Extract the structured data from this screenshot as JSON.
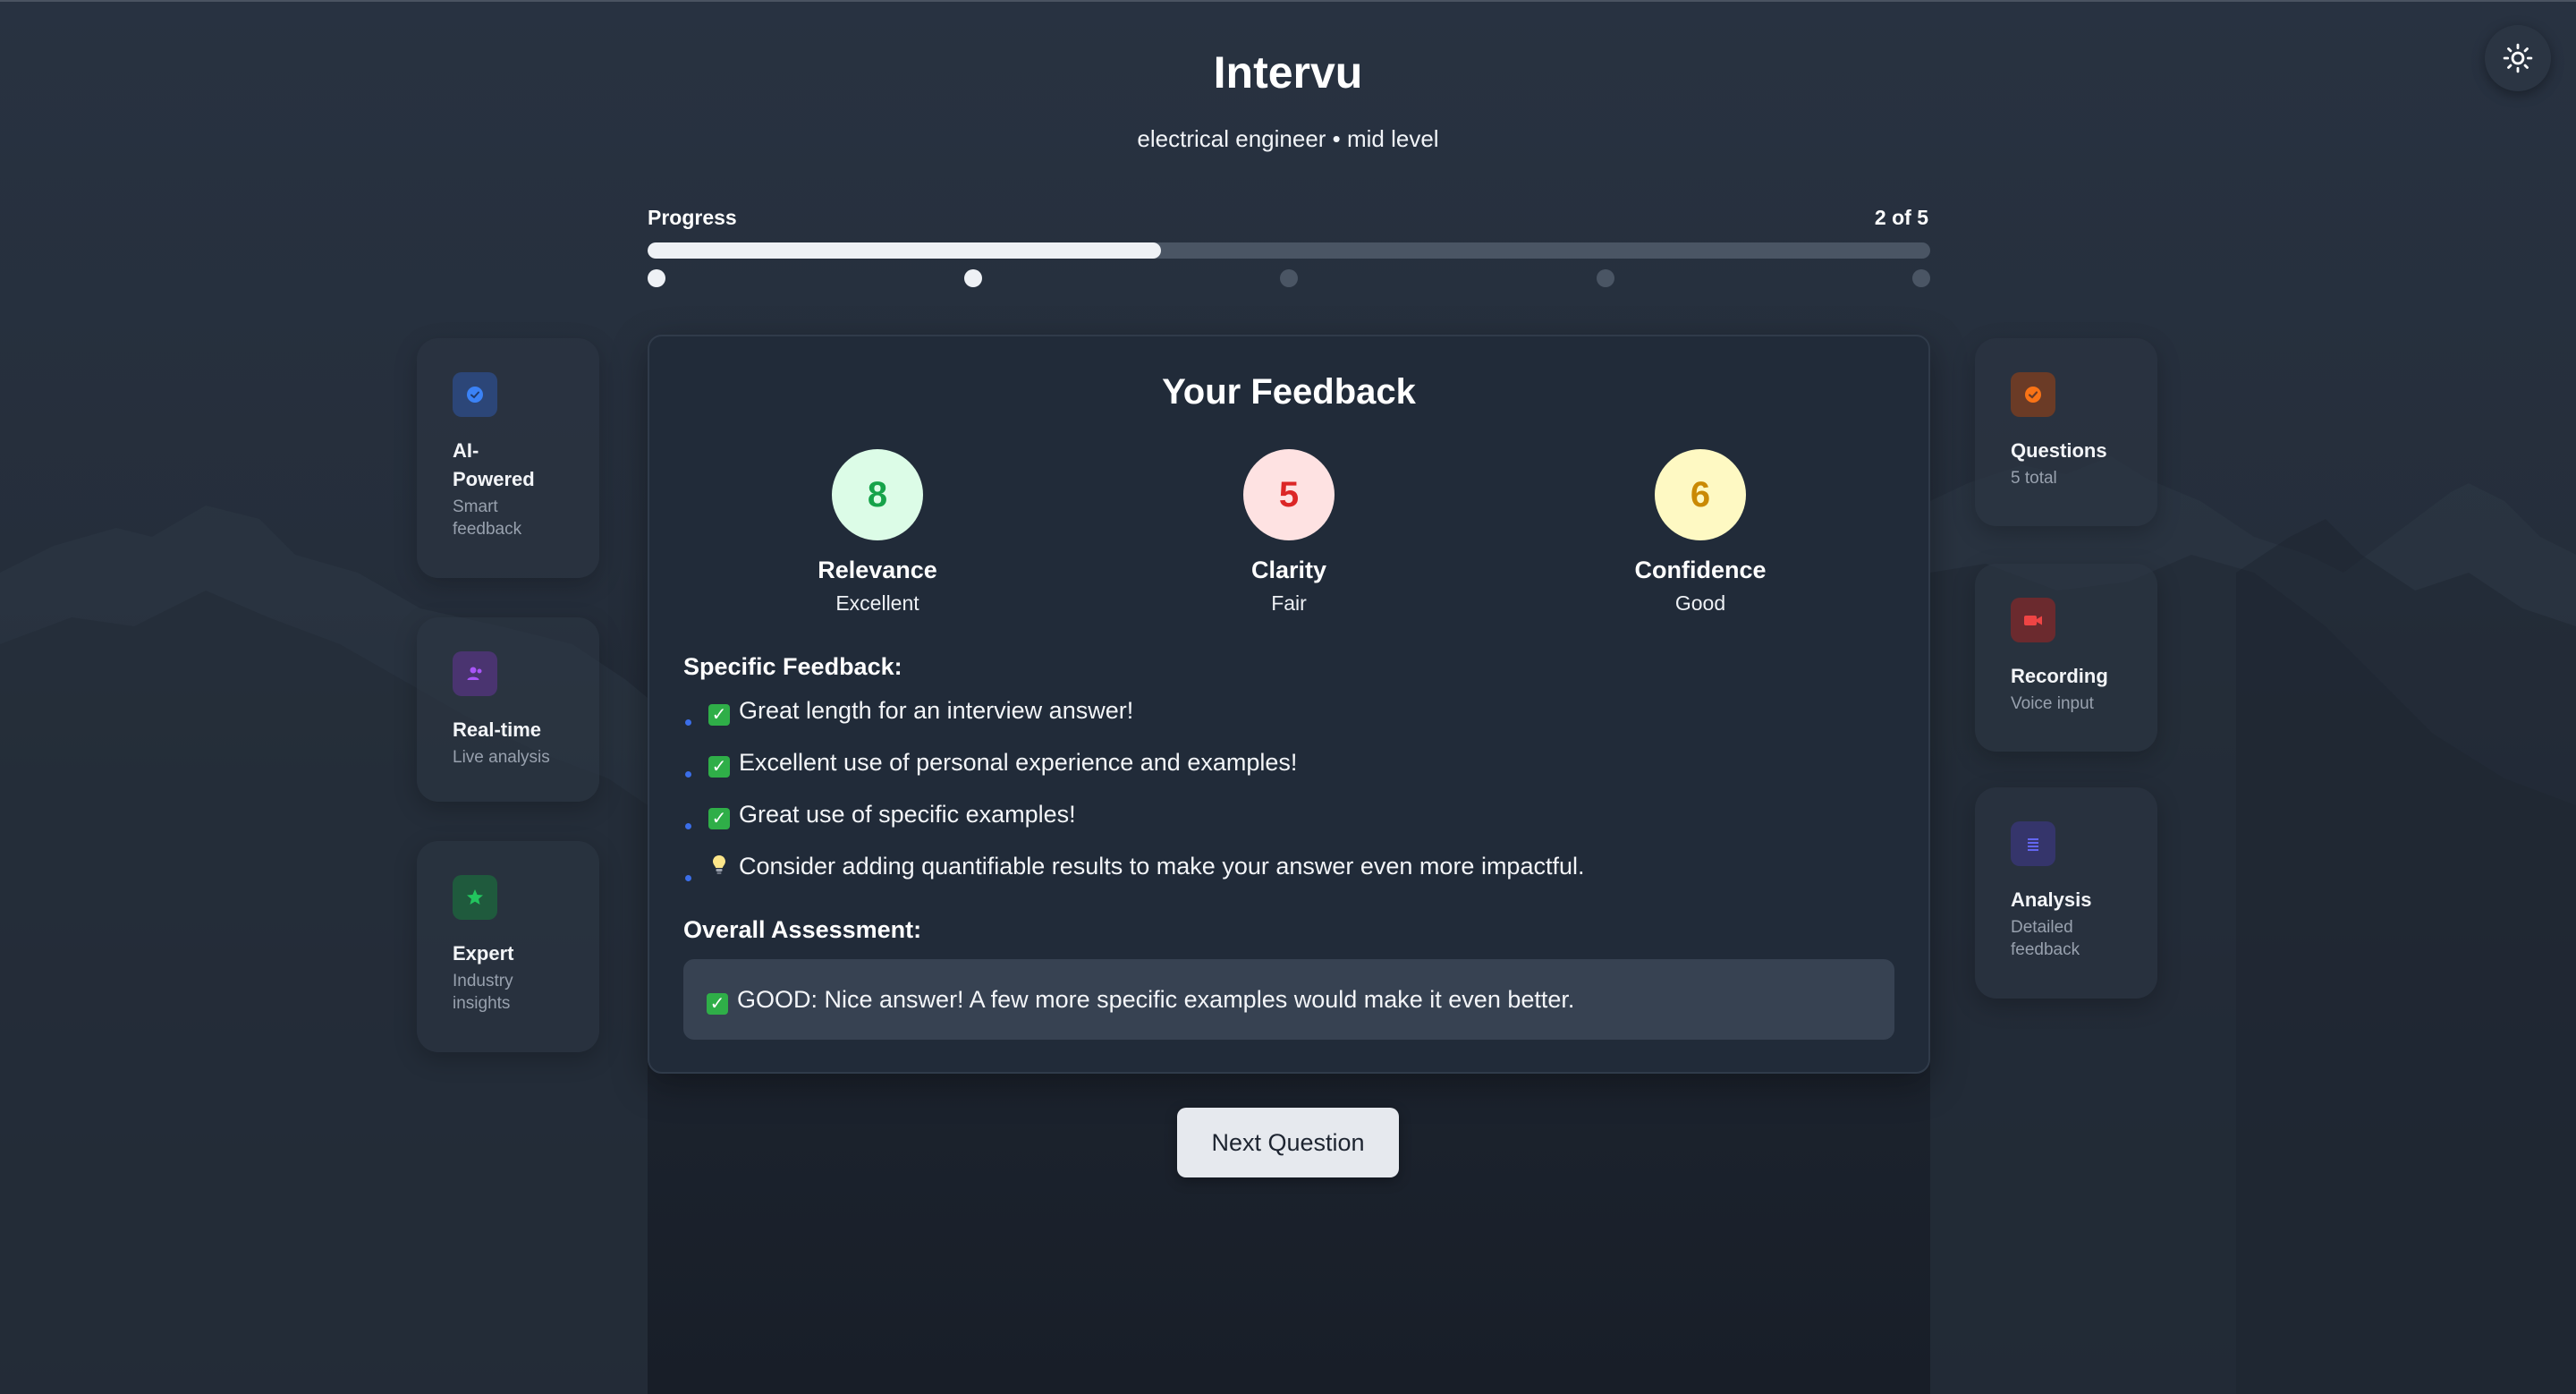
{
  "app": {
    "title": "Intervu",
    "subtitle": "electrical engineer • mid level"
  },
  "theme_toggle": {
    "icon": "sun-icon"
  },
  "progress": {
    "label": "Progress",
    "count_text": "2 of 5",
    "current": 2,
    "total": 5,
    "fill_fraction": 0.4
  },
  "left_features": [
    {
      "title": "AI-\nPowered",
      "desc": "Smart\nfeedback",
      "icon": "ai-badge-icon",
      "color": "#3b82f6"
    },
    {
      "title": "Real-time",
      "desc": "Live analysis",
      "icon": "users-icon",
      "color": "#a855f7"
    },
    {
      "title": "Expert",
      "desc": "Industry\ninsights",
      "icon": "star-icon",
      "color": "#22c55e"
    }
  ],
  "right_features": [
    {
      "title": "Questions",
      "desc": "5 total",
      "icon": "check-circle-icon",
      "color": "#f97316"
    },
    {
      "title": "Recording",
      "desc": "Voice input",
      "icon": "video-camera-icon",
      "color": "#ef4444"
    },
    {
      "title": "Analysis",
      "desc": "Detailed\nfeedback",
      "icon": "list-icon",
      "color": "#6366f1"
    }
  ],
  "feedback": {
    "title": "Your Feedback",
    "scores": [
      {
        "value": "8",
        "name": "Relevance",
        "grade": "Excellent",
        "bg": "#dcfce7",
        "fg": "#16a34a"
      },
      {
        "value": "5",
        "name": "Clarity",
        "grade": "Fair",
        "bg": "#fee2e2",
        "fg": "#dc2626"
      },
      {
        "value": "6",
        "name": "Confidence",
        "grade": "Good",
        "bg": "#fef9c3",
        "fg": "#ca8a04"
      }
    ],
    "specific_heading": "Specific Feedback:",
    "items": [
      {
        "emoji": "check",
        "text": "Great length for an interview answer!"
      },
      {
        "emoji": "check",
        "text": "Excellent use of personal experience and examples!"
      },
      {
        "emoji": "check",
        "text": "Great use of specific examples!"
      },
      {
        "emoji": "bulb",
        "text": "Consider adding quantifiable results to make your answer even more impactful."
      }
    ],
    "overall_heading": "Overall Assessment:",
    "overall_text": "GOOD: Nice answer! A few more specific examples would make it even better."
  },
  "next_button": "Next Question"
}
